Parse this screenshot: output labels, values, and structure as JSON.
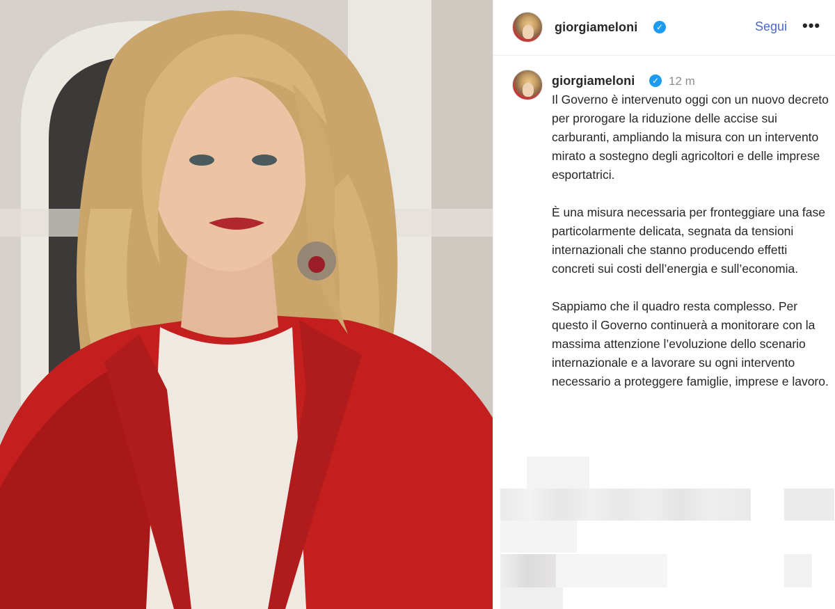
{
  "post": {
    "username": "giorgiameloni",
    "verified_icon": "✓",
    "follow_label": "Segui",
    "more_label": "•••",
    "time": "12 m",
    "caption": [
      "Il Governo è intervenuto oggi con un nuovo decreto per prorogare la riduzione delle accise sui carburanti, ampliando la misura con un intervento mirato a sostegno degli agricoltori e delle imprese esportatrici.",
      "È una misura necessaria per fronteggiare una fase particolarmente delicata, segnata da tensioni internazionali che stanno producendo effetti concreti sui costi dell’energia e sull’economia.",
      "Sappiamo che il quadro resta complesso. Per questo il Governo continuerà a monitorare con la massima attenzione l’evoluzione dello scenario internazionale e a lavorare su ogni intervento necessario a proteggere famiglie, imprese e lavoro."
    ]
  },
  "colors": {
    "accent_link": "#4a67c8",
    "verified": "#1d9bf0",
    "jacket": "#c41f1f"
  }
}
